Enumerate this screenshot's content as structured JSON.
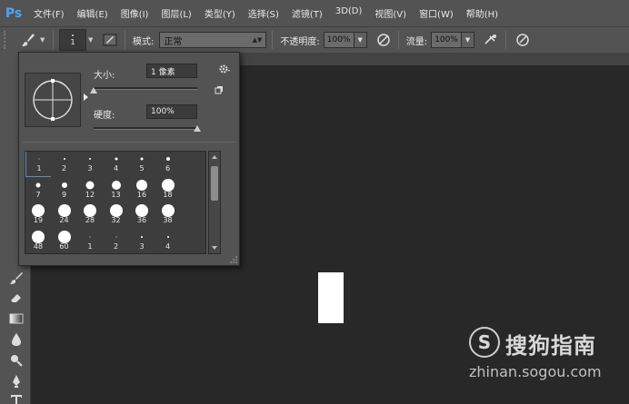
{
  "app": {
    "logo_text": "Ps",
    "accent": "#4aa3ff"
  },
  "menu": [
    "文件(F)",
    "编辑(E)",
    "图像(I)",
    "图层(L)",
    "类型(Y)",
    "选择(S)",
    "滤镜(T)",
    "3D(D)",
    "视图(V)",
    "窗口(W)",
    "帮助(H)"
  ],
  "options": {
    "brush_size": "1",
    "mode_label": "模式:",
    "mode_value": "正常",
    "opacity_label": "不透明度:",
    "opacity_value": "100%",
    "flow_label": "流量:",
    "flow_value": "100%"
  },
  "brush_popover": {
    "size_label": "大小:",
    "size_value": "1 像素",
    "size_slider": 0.0,
    "hardness_label": "硬度:",
    "hardness_value": "100%",
    "hardness_slider": 1.0,
    "presets": [
      {
        "label": "1",
        "dot": 1
      },
      {
        "label": "2",
        "dot": 2
      },
      {
        "label": "3",
        "dot": 2
      },
      {
        "label": "4",
        "dot": 3
      },
      {
        "label": "5",
        "dot": 3
      },
      {
        "label": "6",
        "dot": 4
      },
      {
        "label": "7",
        "dot": 5
      },
      {
        "label": "9",
        "dot": 6
      },
      {
        "label": "12",
        "dot": 9
      },
      {
        "label": "13",
        "dot": 10
      },
      {
        "label": "16",
        "dot": 12
      },
      {
        "label": "18",
        "dot": 14
      },
      {
        "label": "19",
        "dot": 14
      },
      {
        "label": "24",
        "dot": 14
      },
      {
        "label": "28",
        "dot": 14
      },
      {
        "label": "32",
        "dot": 14
      },
      {
        "label": "36",
        "dot": 14
      },
      {
        "label": "38",
        "dot": 14
      },
      {
        "label": "48",
        "dot": 14
      },
      {
        "label": "60",
        "dot": 14
      },
      {
        "label": "1",
        "dot": 1
      },
      {
        "label": "2",
        "dot": 1
      },
      {
        "label": "3",
        "dot": 2
      },
      {
        "label": "4",
        "dot": 2
      }
    ],
    "selected_index": 0
  },
  "toolbar_icons": [
    "brush-icon",
    "history-brush-icon",
    "eraser-icon",
    "gradient-icon",
    "blur-icon",
    "dodge-icon",
    "pen-icon",
    "type-icon"
  ],
  "watermark": {
    "logo_letter": "S",
    "text": "搜狗指南",
    "url": "zhinan.sogou.com"
  }
}
